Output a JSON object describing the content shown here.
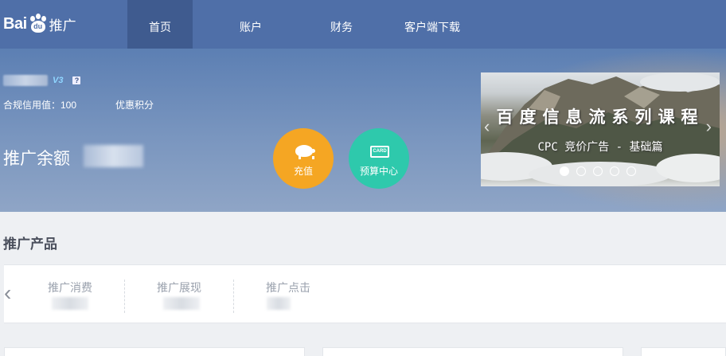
{
  "logo": {
    "brand_text": "Bai",
    "brand_paw_text": "du",
    "product_text": "推广"
  },
  "nav": {
    "items": [
      {
        "label": "首页",
        "active": true
      },
      {
        "label": "账户",
        "active": false
      },
      {
        "label": "财务",
        "active": false
      },
      {
        "label": "客户端下载",
        "active": false
      }
    ]
  },
  "account": {
    "vip_badge": "V3",
    "help_badge": "?",
    "credit_label": "合规信用值：100",
    "points_label": "优惠积分",
    "balance_label": "推广余额"
  },
  "actions": {
    "recharge_label": "充值",
    "budget_label": "预算中心",
    "budget_icon_text": "CARD"
  },
  "banner": {
    "title": "百度信息流系列课程",
    "subtitle": "CPC 竞价广告 - 基础篇",
    "slide_count": 5,
    "active_slide": 1
  },
  "products": {
    "section_title": "推广产品",
    "stats": [
      {
        "label": "推广消费"
      },
      {
        "label": "推广展现"
      },
      {
        "label": "推广点击"
      }
    ]
  },
  "colors": {
    "nav_bg": "#4f6fa8",
    "nav_active_bg": "#3f5b8f",
    "recharge": "#f5a623",
    "budget": "#2ec9ac"
  }
}
